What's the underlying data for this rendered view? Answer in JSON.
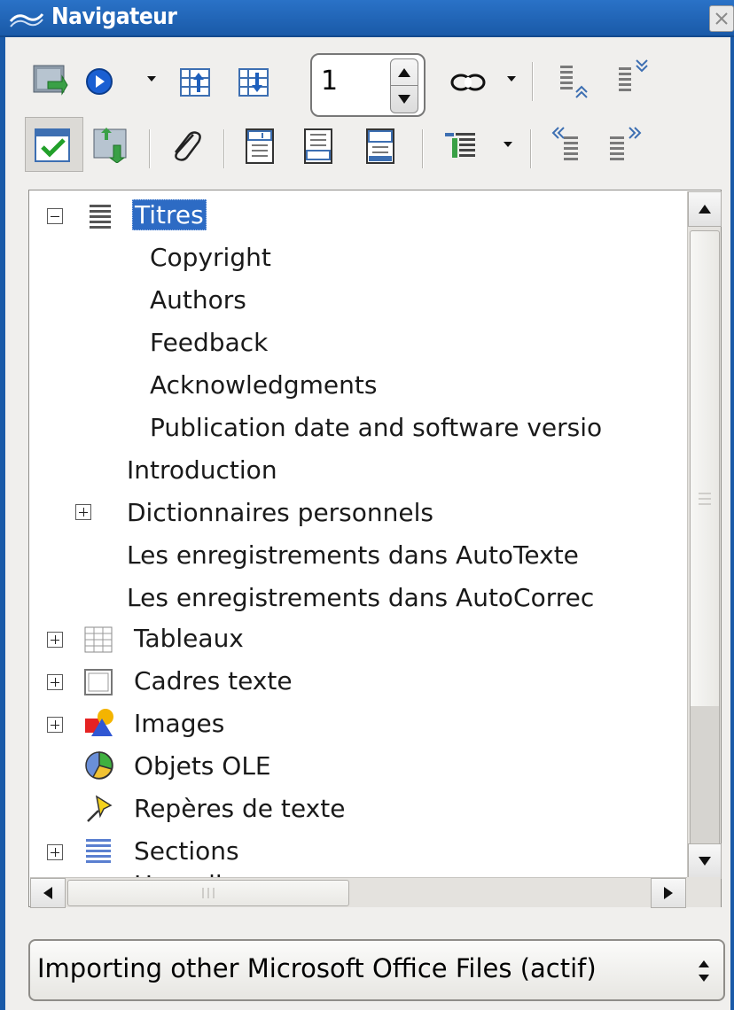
{
  "window": {
    "title": "Navigateur"
  },
  "toolbar": {
    "page_number": "1",
    "icons": [
      "navigation-toggle-icon",
      "navigation-target-icon",
      "previous-page-icon",
      "next-page-icon",
      "link-icon",
      "promote-level-icon",
      "demote-level-icon",
      "list-box-icon",
      "drag-mode-icon",
      "reminder-icon",
      "header-icon",
      "footer-icon",
      "anchor-icon",
      "heading-levels-icon",
      "demote-chapter-icon",
      "promote-chapter-icon"
    ]
  },
  "tree": {
    "items": [
      {
        "label": "Titres",
        "level": 0,
        "expander": "minus",
        "icon": "headings-icon",
        "selected": true
      },
      {
        "label": "Copyright",
        "level": 2
      },
      {
        "label": "Authors",
        "level": 2
      },
      {
        "label": "Feedback",
        "level": 2
      },
      {
        "label": "Acknowledgments",
        "level": 2
      },
      {
        "label": "Publication date and software versio",
        "level": 2
      },
      {
        "label": "Introduction",
        "level": 1
      },
      {
        "label": "Dictionnaires personnels",
        "level": 1,
        "expander": "plus"
      },
      {
        "label": "Les enregistrements dans AutoTexte",
        "level": 1
      },
      {
        "label": "Les enregistrements dans AutoCorrec",
        "level": 1
      },
      {
        "label": "Tableaux",
        "level": 0,
        "expander": "plus",
        "icon": "table-icon"
      },
      {
        "label": "Cadres texte",
        "level": 0,
        "expander": "plus",
        "icon": "frame-icon"
      },
      {
        "label": "Images",
        "level": 0,
        "expander": "plus",
        "icon": "image-icon"
      },
      {
        "label": "Objets OLE",
        "level": 0,
        "icon": "ole-object-icon"
      },
      {
        "label": "Repères de texte",
        "level": 0,
        "icon": "bookmark-icon"
      },
      {
        "label": "Sections",
        "level": 0,
        "expander": "plus",
        "icon": "sections-icon"
      }
    ],
    "partial_next": "Hyperliens"
  },
  "document_select": {
    "value": "Importing other Microsoft Office Files (actif)"
  }
}
